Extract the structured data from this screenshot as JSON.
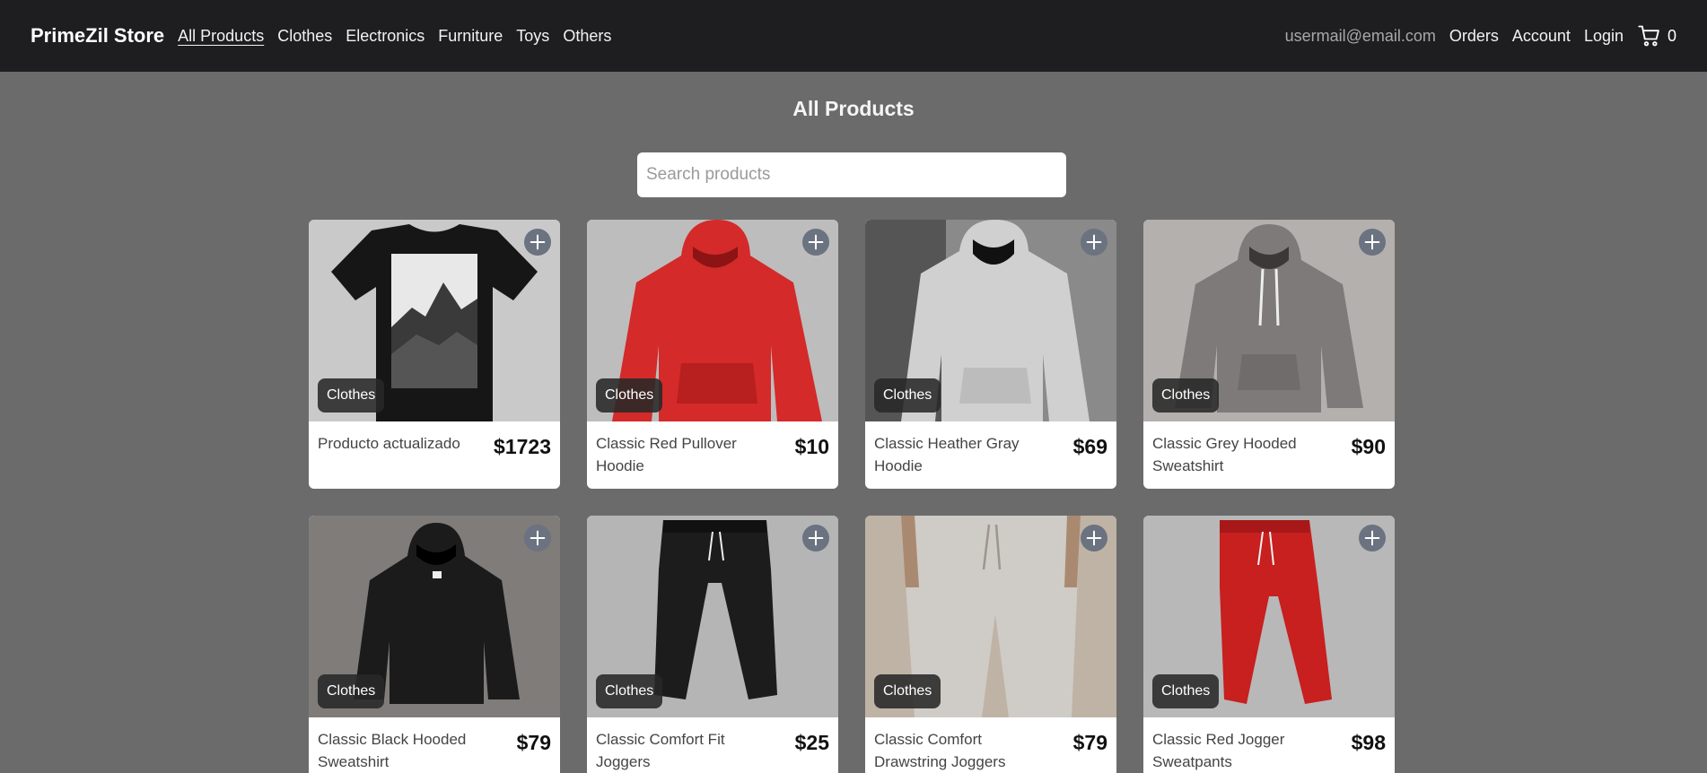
{
  "nav": {
    "brand": "PrimeZil Store",
    "links": [
      "All Products",
      "Clothes",
      "Electronics",
      "Furniture",
      "Toys",
      "Others"
    ],
    "user_email": "usermail@email.com",
    "orders": "Orders",
    "account": "Account",
    "login": "Login",
    "cart_count": "0"
  },
  "page_title": "All Products",
  "search": {
    "placeholder": "Search products",
    "value": ""
  },
  "products": [
    {
      "name": "Producto actualizado",
      "price": "$1723",
      "category": "Clothes",
      "image": "black-tshirt-mountain"
    },
    {
      "name": "Classic Red Pullover Hoodie",
      "price": "$10",
      "category": "Clothes",
      "image": "red-hoodie"
    },
    {
      "name": "Classic Heather Gray Hoodie",
      "price": "$69",
      "category": "Clothes",
      "image": "light-gray-hoodie"
    },
    {
      "name": "Classic Grey Hooded Sweatshirt",
      "price": "$90",
      "category": "Clothes",
      "image": "gray-hoodie"
    },
    {
      "name": "Classic Black Hooded Sweatshirt",
      "price": "$79",
      "category": "Clothes",
      "image": "black-hoodie"
    },
    {
      "name": "Classic Comfort Fit Joggers",
      "price": "$25",
      "category": "Clothes",
      "image": "black-joggers"
    },
    {
      "name": "Classic Comfort Drawstring Joggers",
      "price": "$79",
      "category": "Clothes",
      "image": "beige-joggers"
    },
    {
      "name": "Classic Red Jogger Sweatpants",
      "price": "$98",
      "category": "Clothes",
      "image": "red-joggers"
    }
  ],
  "colors": {
    "navbar": "#1e1e20",
    "background": "#6b6b6b",
    "add_button": "#6b7280"
  }
}
